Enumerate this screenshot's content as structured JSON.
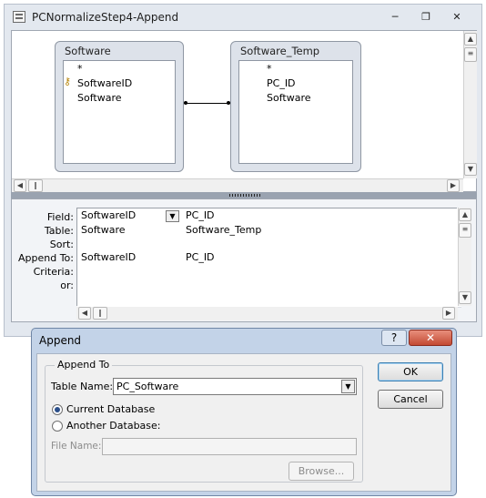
{
  "window": {
    "title": "PCNormalizeStep4-Append"
  },
  "tables": {
    "left": {
      "name": "Software",
      "fields": [
        "*",
        "SoftwareID",
        "Software"
      ]
    },
    "right": {
      "name": "Software_Temp",
      "fields": [
        "*",
        "PC_ID",
        "Software"
      ]
    }
  },
  "grid": {
    "row_labels": {
      "field": "Field:",
      "table": "Table:",
      "sort": "Sort:",
      "append_to": "Append To:",
      "criteria": "Criteria:",
      "or": "or:"
    },
    "col1": {
      "field": "SoftwareID",
      "table": "Software",
      "append_to": "SoftwareID"
    },
    "col2": {
      "field": "PC_ID",
      "table": "Software_Temp",
      "append_to": "PC_ID"
    }
  },
  "dialog": {
    "title": "Append",
    "help_label": "?",
    "close_label": "✕",
    "group_label": "Append To",
    "table_name_label": "Table Name:",
    "table_name_value": "PC_Software",
    "current_db_label": "Current Database",
    "another_db_label": "Another Database:",
    "file_name_label": "File Name:",
    "file_name_value": "",
    "browse_label": "Browse...",
    "ok_label": "OK",
    "cancel_label": "Cancel",
    "selected_option": "current"
  }
}
